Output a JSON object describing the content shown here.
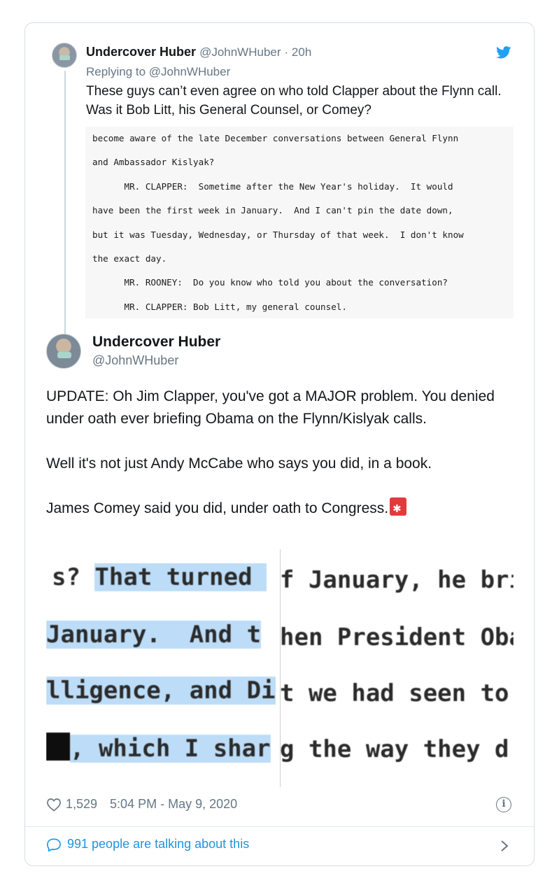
{
  "quoted_tweet": {
    "name": "Undercover Huber",
    "handle": "@JohnWHuber",
    "time": "· 20h",
    "replying_to": "Replying to @JohnWHuber",
    "text": "These guys can’t even agree on who told Clapper about the Flynn call. Was it Bob Litt, his General Counsel, or Comey?",
    "transcript_lines": [
      "become aware of the late December conversations between General Flynn",
      "and Ambassador Kislyak?",
      "      MR. CLAPPER:  Sometime after the New Year's holiday.  It would",
      "have been the first week in January.  And I can't pin the date down,",
      "but it was Tuesday, Wednesday, or Thursday of that week.  I don't know",
      "the exact day.",
      "      MR. ROONEY:  Do you know who told you about the conversation?",
      "      MR. CLAPPER: Bob Litt, my general counsel."
    ]
  },
  "main_tweet": {
    "name": "Undercover Huber",
    "handle": "@JohnWHuber",
    "para1": "UPDATE: Oh Jim Clapper, you've got a MAJOR problem. You denied under oath ever briefing Obama on the Flynn/Kislyak calls.",
    "para2": "Well it's not just Andy McCabe who says you did, in a book.",
    "para3": "James Comey said you did, under oath to Congress.",
    "image_left": [
      "s? ",
      "That turned ",
      "January.  And t",
      "lligence, and Di",
      ", which I shar"
    ],
    "image_right": [
      "f January, he bri",
      "hen President Oba",
      "t we had seen to",
      "g the way they d"
    ],
    "likes": "1,529",
    "timestamp": "5:04 PM - May 9, 2020",
    "talking": "991 people are talking about this"
  },
  "colors": {
    "twitter_blue": "#1da1f2",
    "link_blue": "#1b95e0",
    "highlight": "#bcdcf7",
    "muted": "#657786"
  }
}
